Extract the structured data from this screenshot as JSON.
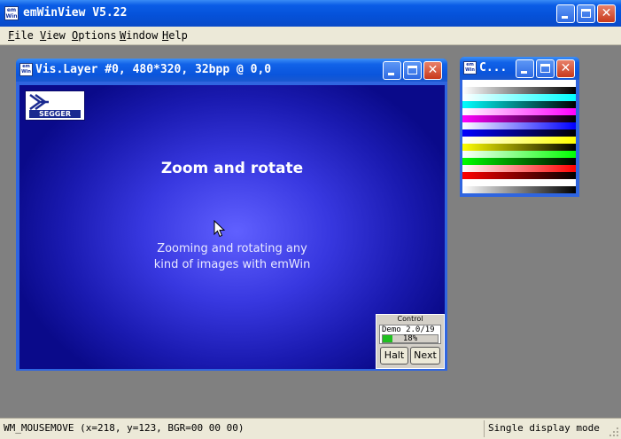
{
  "app": {
    "icon_text": "em Win",
    "title": "emWinView V5.22"
  },
  "menu": [
    {
      "key": "F",
      "rest": "ile"
    },
    {
      "key": "V",
      "rest": "iew"
    },
    {
      "key": "O",
      "rest": "ptions"
    },
    {
      "key": "W",
      "rest": "indow"
    },
    {
      "key": "H",
      "rest": "elp"
    }
  ],
  "layer_window": {
    "title": "Vis.Layer #0, 480*320, 32bpp @ 0,0",
    "logo_text": "SEGGER",
    "heading": "Zoom and rotate",
    "line1": "Zooming and rotating any",
    "line2": "kind of images with emWin",
    "control": {
      "title": "Control",
      "demo": "Demo 2.0/19",
      "progress_label": "18%",
      "progress": 0.18,
      "halt": "Halt",
      "next": "Next"
    }
  },
  "color_window": {
    "title": "C...",
    "bars": [
      {
        "from": "#ffffff",
        "to": "#000000"
      },
      {
        "from": "#00ffff",
        "to": "#000000"
      },
      {
        "from": "#ff00ff",
        "to": "#000000"
      },
      {
        "from": "#0000ff",
        "to": "#000000"
      },
      {
        "from": "#ffff00",
        "to": "#000000"
      },
      {
        "from": "#00ff00",
        "to": "#000000"
      },
      {
        "from": "#ff0000",
        "to": "#000000"
      },
      {
        "from": "#ffffff",
        "to": "#000000"
      }
    ]
  },
  "status": {
    "left": "WM_MOUSEMOVE (x=218, y=123, BGR=00 00 00)",
    "right": "Single display mode"
  }
}
